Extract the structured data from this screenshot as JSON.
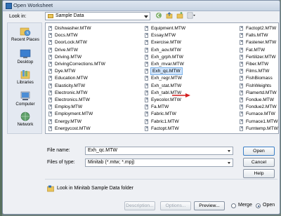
{
  "window": {
    "title": "Open Worksheet"
  },
  "lookin": {
    "label": "Look in:",
    "folder": "Sample Data"
  },
  "places": [
    {
      "label": "Recent Places",
      "icon": "recent-places-icon"
    },
    {
      "label": "Desktop",
      "icon": "desktop-icon"
    },
    {
      "label": "Libraries",
      "icon": "libraries-icon"
    },
    {
      "label": "Computer",
      "icon": "computer-icon"
    },
    {
      "label": "Network",
      "icon": "network-icon"
    }
  ],
  "files": [
    [
      "Dishwasher.MTW",
      "Docs.MTW",
      "DoorLock.MTW",
      "Drive.MTW",
      "Driving.MTW",
      "DrivingCorrections.MTW",
      "Dye.MTW",
      "Education.MTW",
      "Elasticity.MTW",
      "Electronic.MTW",
      "Electronics.MTW",
      "Employ.MTW",
      "Employment.MTW",
      "Energy.MTW",
      "Energycost.MTW"
    ],
    [
      "Equipment.MTW",
      "Essay.MTW",
      "Exercise.MTW",
      "Exh_aov.MTW",
      "Exh_grph.MTW",
      "Exh_mvar.MTW",
      "Exh_qc.MTW",
      "Exh_regr.MTW",
      "Exh_stat.MTW",
      "Exh_tabl.MTW",
      "Eyecolor.MTW",
      "Fa.MTW",
      "Fabric.MTW",
      "Fabric1.MTW",
      "Factopt.MTW"
    ],
    [
      "Factopt2.MTW",
      "Falls.MTW",
      "Fastener.MTW",
      "Fat.MTW",
      "Fertilizer.MTW",
      "Fiber.MTW",
      "Films.MTW",
      "FishBiomass",
      "FishWeights",
      "Flamertd.MTW",
      "Fondue.MTW",
      "Fondue2.MTW",
      "Furnace.MTW",
      "Furnace1.MTW",
      "Furntemp.MTW"
    ]
  ],
  "selected_file": "Exh_qc.MTW",
  "filename": {
    "label": "File name:",
    "value": "Exh_qc.MTW"
  },
  "filetype": {
    "label": "Files of type:",
    "value": "Minitab (*.mtw; *.mpj)"
  },
  "buttons": {
    "open": "Open",
    "cancel": "Cancel",
    "help": "Help",
    "description": "Description...",
    "options": "Options...",
    "preview": "Preview..."
  },
  "look_in_minitab": "Look in Minitab Sample Data folder",
  "merge_open": {
    "merge": "Merge",
    "open": "Open",
    "selected": "Open"
  },
  "colors": {
    "accent": "#3c7fc5",
    "arrow": "#d42020",
    "selection": "#cfe3fa"
  }
}
